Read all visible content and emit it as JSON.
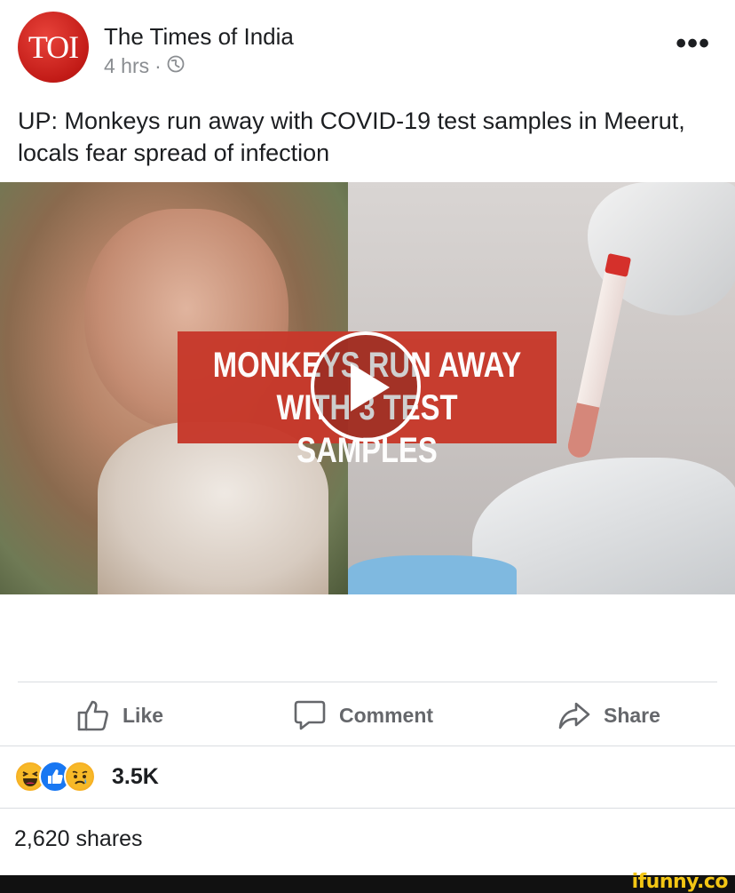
{
  "post": {
    "page_name": "The Times of India",
    "avatar_text": "TOI",
    "time": "4 hrs",
    "separator": "·",
    "audience_icon": "globe-icon",
    "more_label": "•••",
    "headline": "UP: Monkeys run away with COVID-19 test samples in Meerut, locals fear spread of infection"
  },
  "media": {
    "banner_line1": "MONKEYS RUN AWAY",
    "banner_line2": "WITH 3 TEST SAMPLES",
    "play_icon": "play-icon"
  },
  "actions": [
    {
      "label": "Like",
      "icon": "thumbs-up-icon"
    },
    {
      "label": "Comment",
      "icon": "comment-icon"
    },
    {
      "label": "Share",
      "icon": "share-arrow-icon"
    }
  ],
  "engagement": {
    "reactions": [
      "haha-icon",
      "like-icon",
      "sad-icon"
    ],
    "reaction_count": "3.5K",
    "shares": "2,620 shares"
  },
  "watermark": {
    "text": "ifunny.co"
  },
  "colors": {
    "brand_red": "#c7392b",
    "text": "#1c1e21",
    "secondary": "#65676b",
    "like_blue": "#1877f2"
  }
}
